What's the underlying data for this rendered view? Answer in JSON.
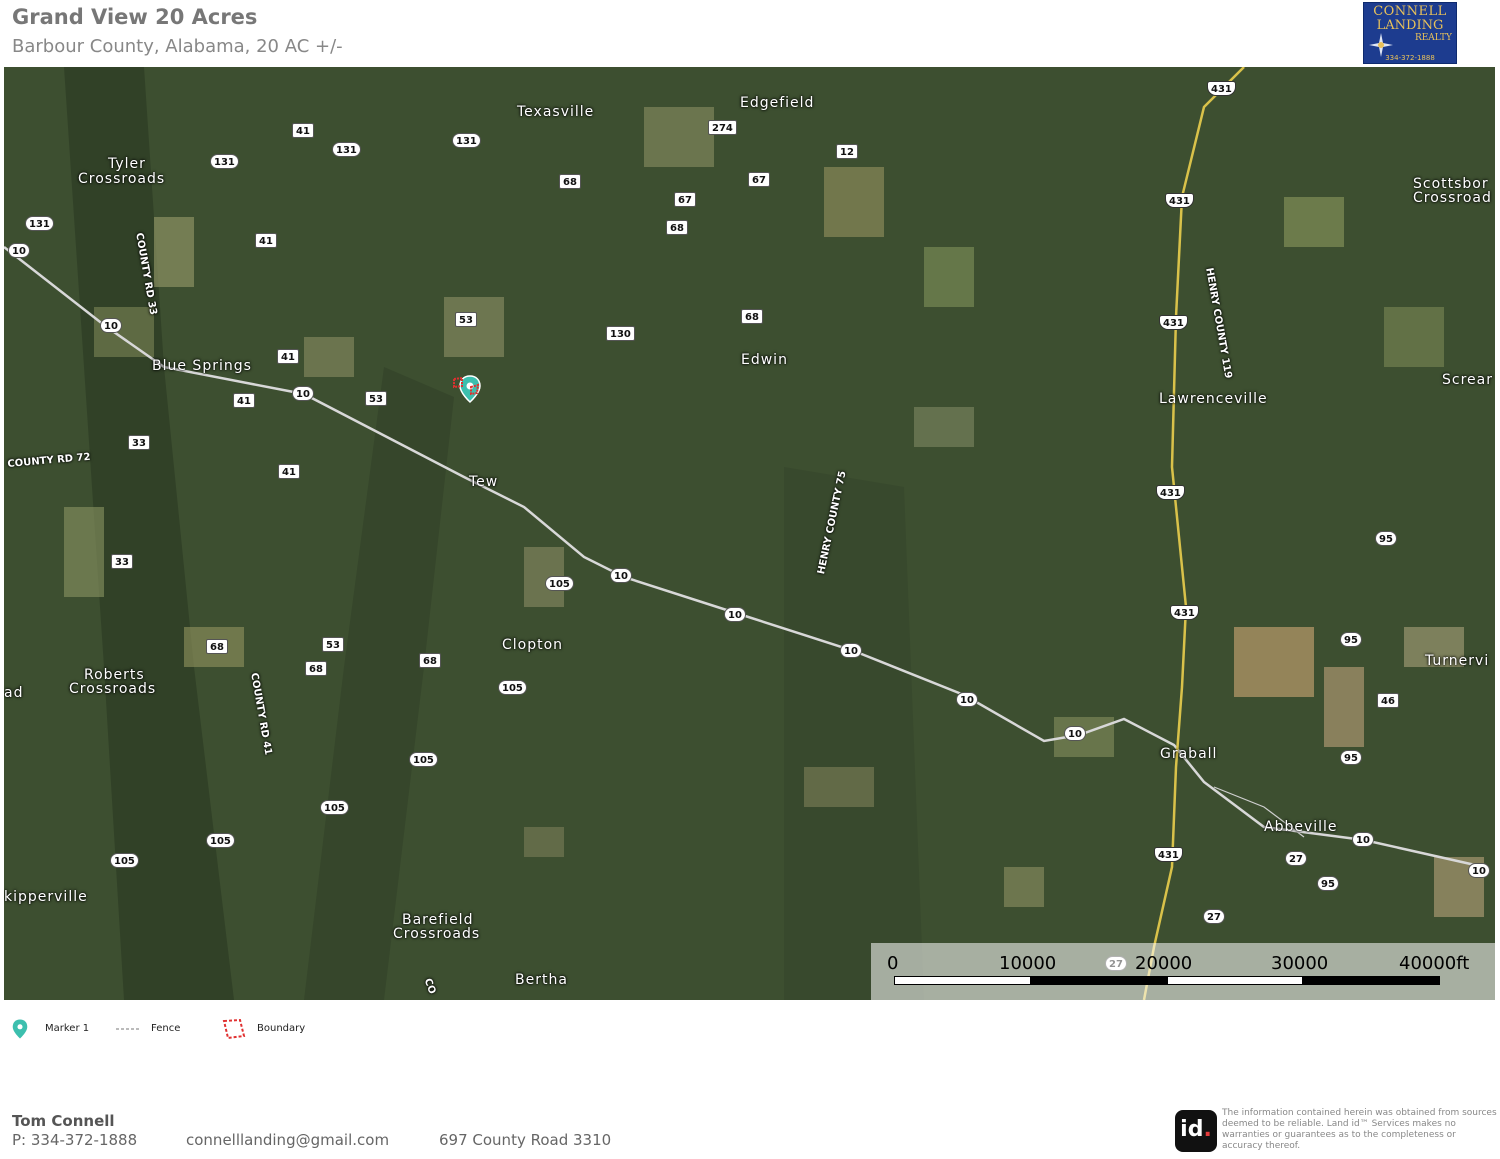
{
  "header": {
    "title": "Grand View 20 Acres",
    "subtitle": "Barbour County, Alabama, 20 AC +/-"
  },
  "logo": {
    "line1": "CONNELL",
    "line2": "LANDING",
    "line3": "REALTY",
    "phone": "334-372-1888"
  },
  "map": {
    "place_labels": {
      "texasville": "Texasville",
      "edgefield": "Edgefield",
      "tyler_crossroads_1": "Tyler",
      "tyler_crossroads_2": "Crossroads",
      "scottsboro_1": "Scottsbor",
      "scottsboro_2": "Crossroad",
      "blue_springs": "Blue Springs",
      "edwin": "Edwin",
      "lawrenceville": "Lawrenceville",
      "screamer": "Screar",
      "tew": "Tew",
      "clopton": "Clopton",
      "turnerville": "Turnervi",
      "roberts_1": "Roberts",
      "roberts_2": "Crossroads",
      "left_ad": "ad",
      "graball": "Graball",
      "abbeville": "Abbeville",
      "skipperville": "kipperville",
      "barefield_1": "Barefield",
      "barefield_2": "Crossroads",
      "bertha": "Bertha"
    },
    "road_labels": {
      "county_rd_33": "COUNTY RD 33",
      "county_rd_72": "COUNTY RD 72",
      "county_rd_41": "COUNTY RD 41",
      "henry_county_75": "HENRY COUNTY 75",
      "henry_county_119": "HENRY COUNTY 119",
      "bottom_co": "CO"
    },
    "shields": {
      "s_41_a": "41",
      "s_131_a": "131",
      "s_131_b": "131",
      "s_131_c": "131",
      "s_274": "274",
      "s_12": "12",
      "s_68_a": "68",
      "s_67_a": "67",
      "s_67_b": "67",
      "s_68_b": "68",
      "s_10_a": "10",
      "s_41_b": "41",
      "s_10_b": "10",
      "s_53_a": "53",
      "s_130": "130",
      "s_68_c": "68",
      "s_41_c": "41",
      "s_10_c": "10",
      "s_53_b": "53",
      "s_41_d": "41",
      "s_33_a": "33",
      "s_41_e": "41",
      "s_33_b": "33",
      "s_105_a": "105",
      "s_10_d": "10",
      "s_10_e": "10",
      "s_10_f": "10",
      "s_68_d": "68",
      "s_53_c": "53",
      "s_68_e": "68",
      "s_68_f": "68",
      "s_105_b": "105",
      "s_10_g": "10",
      "s_10_h": "10",
      "s_105_c": "105",
      "s_105_d": "105",
      "s_105_e": "105",
      "s_105_f": "105",
      "s_431_a": "431",
      "s_431_b": "431",
      "s_431_c": "431",
      "s_431_d": "431",
      "s_431_e": "431",
      "s_431_f": "431",
      "s_95_a": "95",
      "s_95_b": "95",
      "s_46": "46",
      "s_95_c": "95",
      "s_10_i": "10",
      "s_27_a": "27",
      "s_95_d": "95",
      "s_10_j": "10",
      "s_27_b": "27",
      "s_27_c": "27"
    },
    "scale": {
      "ticks": [
        "0",
        "10000",
        "20000",
        "30000",
        "40000ft"
      ]
    }
  },
  "legend": {
    "marker": "Marker 1",
    "fence": "Fence",
    "boundary": "Boundary"
  },
  "footer": {
    "name": "Tom  Connell",
    "phone": "P: 334-372-1888",
    "email": "connelllanding@gmail.com",
    "address": "697 County Road 3310",
    "id_logo": "id",
    "disclaimer": "The information contained herein was obtained from sources deemed to be reliable. Land id™ Services makes no warranties or guarantees as to the completeness or accuracy thereof."
  },
  "colors": {
    "forest": "#3f5131",
    "field": "#8a8f63",
    "highway": "#d9c24a",
    "road": "#d8d8d8",
    "marker": "#3cbfae",
    "boundary": "#e03030"
  }
}
